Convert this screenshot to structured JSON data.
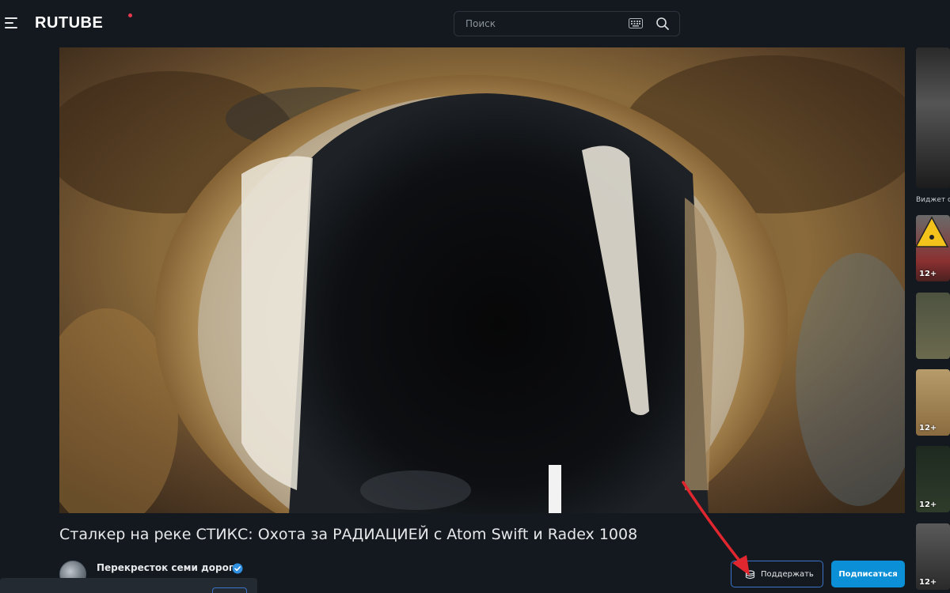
{
  "header": {
    "logo_text": "RUTUBE",
    "logo_dot_color": "#e8384f",
    "menu_icon": "hamburger-icon",
    "search": {
      "placeholder": "Поиск",
      "value": "",
      "keyboard_icon": "keyboard-icon",
      "search_icon": "search-icon"
    }
  },
  "video": {
    "title": "Сталкер на реке СТИКС: Охота за РАДИАЦИЕЙ с Atom Swift и Radex 1008"
  },
  "channel": {
    "name": "Перекресток семи дорог",
    "verified": true,
    "verified_icon": "verified-check-icon"
  },
  "actions": {
    "support_label": "Поддержать",
    "support_icon": "donate-coins-icon",
    "subscribe_label": "Подписаться"
  },
  "sidebar": {
    "caption": "Виджет се",
    "items": [
      {
        "age": ""
      },
      {
        "age": "12+"
      },
      {
        "age": ""
      },
      {
        "age": "12+"
      },
      {
        "age": "12+"
      },
      {
        "age": "12+"
      }
    ]
  },
  "colors": {
    "background": "#14191f",
    "accent": "#0b8fd6",
    "outline": "#3b74c9",
    "annotation_arrow": "#e0262f"
  }
}
